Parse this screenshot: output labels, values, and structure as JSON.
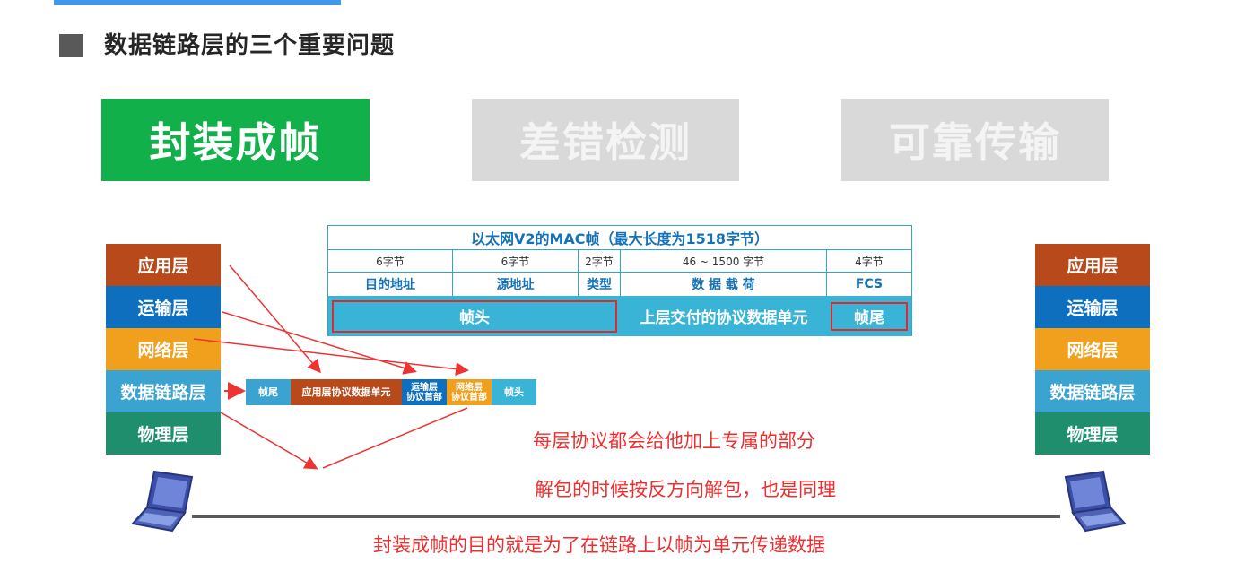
{
  "heading": "数据链路层的三个重要问题",
  "tabs": [
    "封装成帧",
    "差错检测",
    "可靠传输"
  ],
  "layers": [
    "应用层",
    "运输层",
    "网络层",
    "数据链路层",
    "物理层"
  ],
  "frame_table": {
    "title": "以太网V2的MAC帧（最大长度为1518字节）",
    "sizes": [
      "6字节",
      "6字节",
      "2字节",
      "46 ~ 1500 字节",
      "4字节"
    ],
    "fields": [
      "目的地址",
      "源地址",
      "类型",
      "数 据 载 荷",
      "FCS"
    ],
    "bar": {
      "header": "帧头",
      "payload": "上层交付的协议数据单元",
      "trailer": "帧尾"
    }
  },
  "pdu": {
    "trailer": "帧尾",
    "app_unit": "应用层协议数据单元",
    "trans_header_1": "运输层",
    "trans_header_2": "协议首部",
    "net_header_1": "网络层",
    "net_header_2": "协议首部",
    "header": "帧头"
  },
  "notes": {
    "n1": "每层协议都会给他加上专属的部分",
    "n2": "解包的时候按反方向解包，也是同理",
    "n3": "封装成帧的目的就是为了在链路上以帧为单元传递数据"
  },
  "icons": {
    "computer_left": "laptop-icon",
    "computer_right": "laptop-icon",
    "bullet": "square-bullet-icon"
  },
  "colors": {
    "active_tab": "#12b04b",
    "inactive_tab": "#d9d9d9",
    "annotation": "#ee2f2f",
    "table_border": "#2ea6cf"
  }
}
